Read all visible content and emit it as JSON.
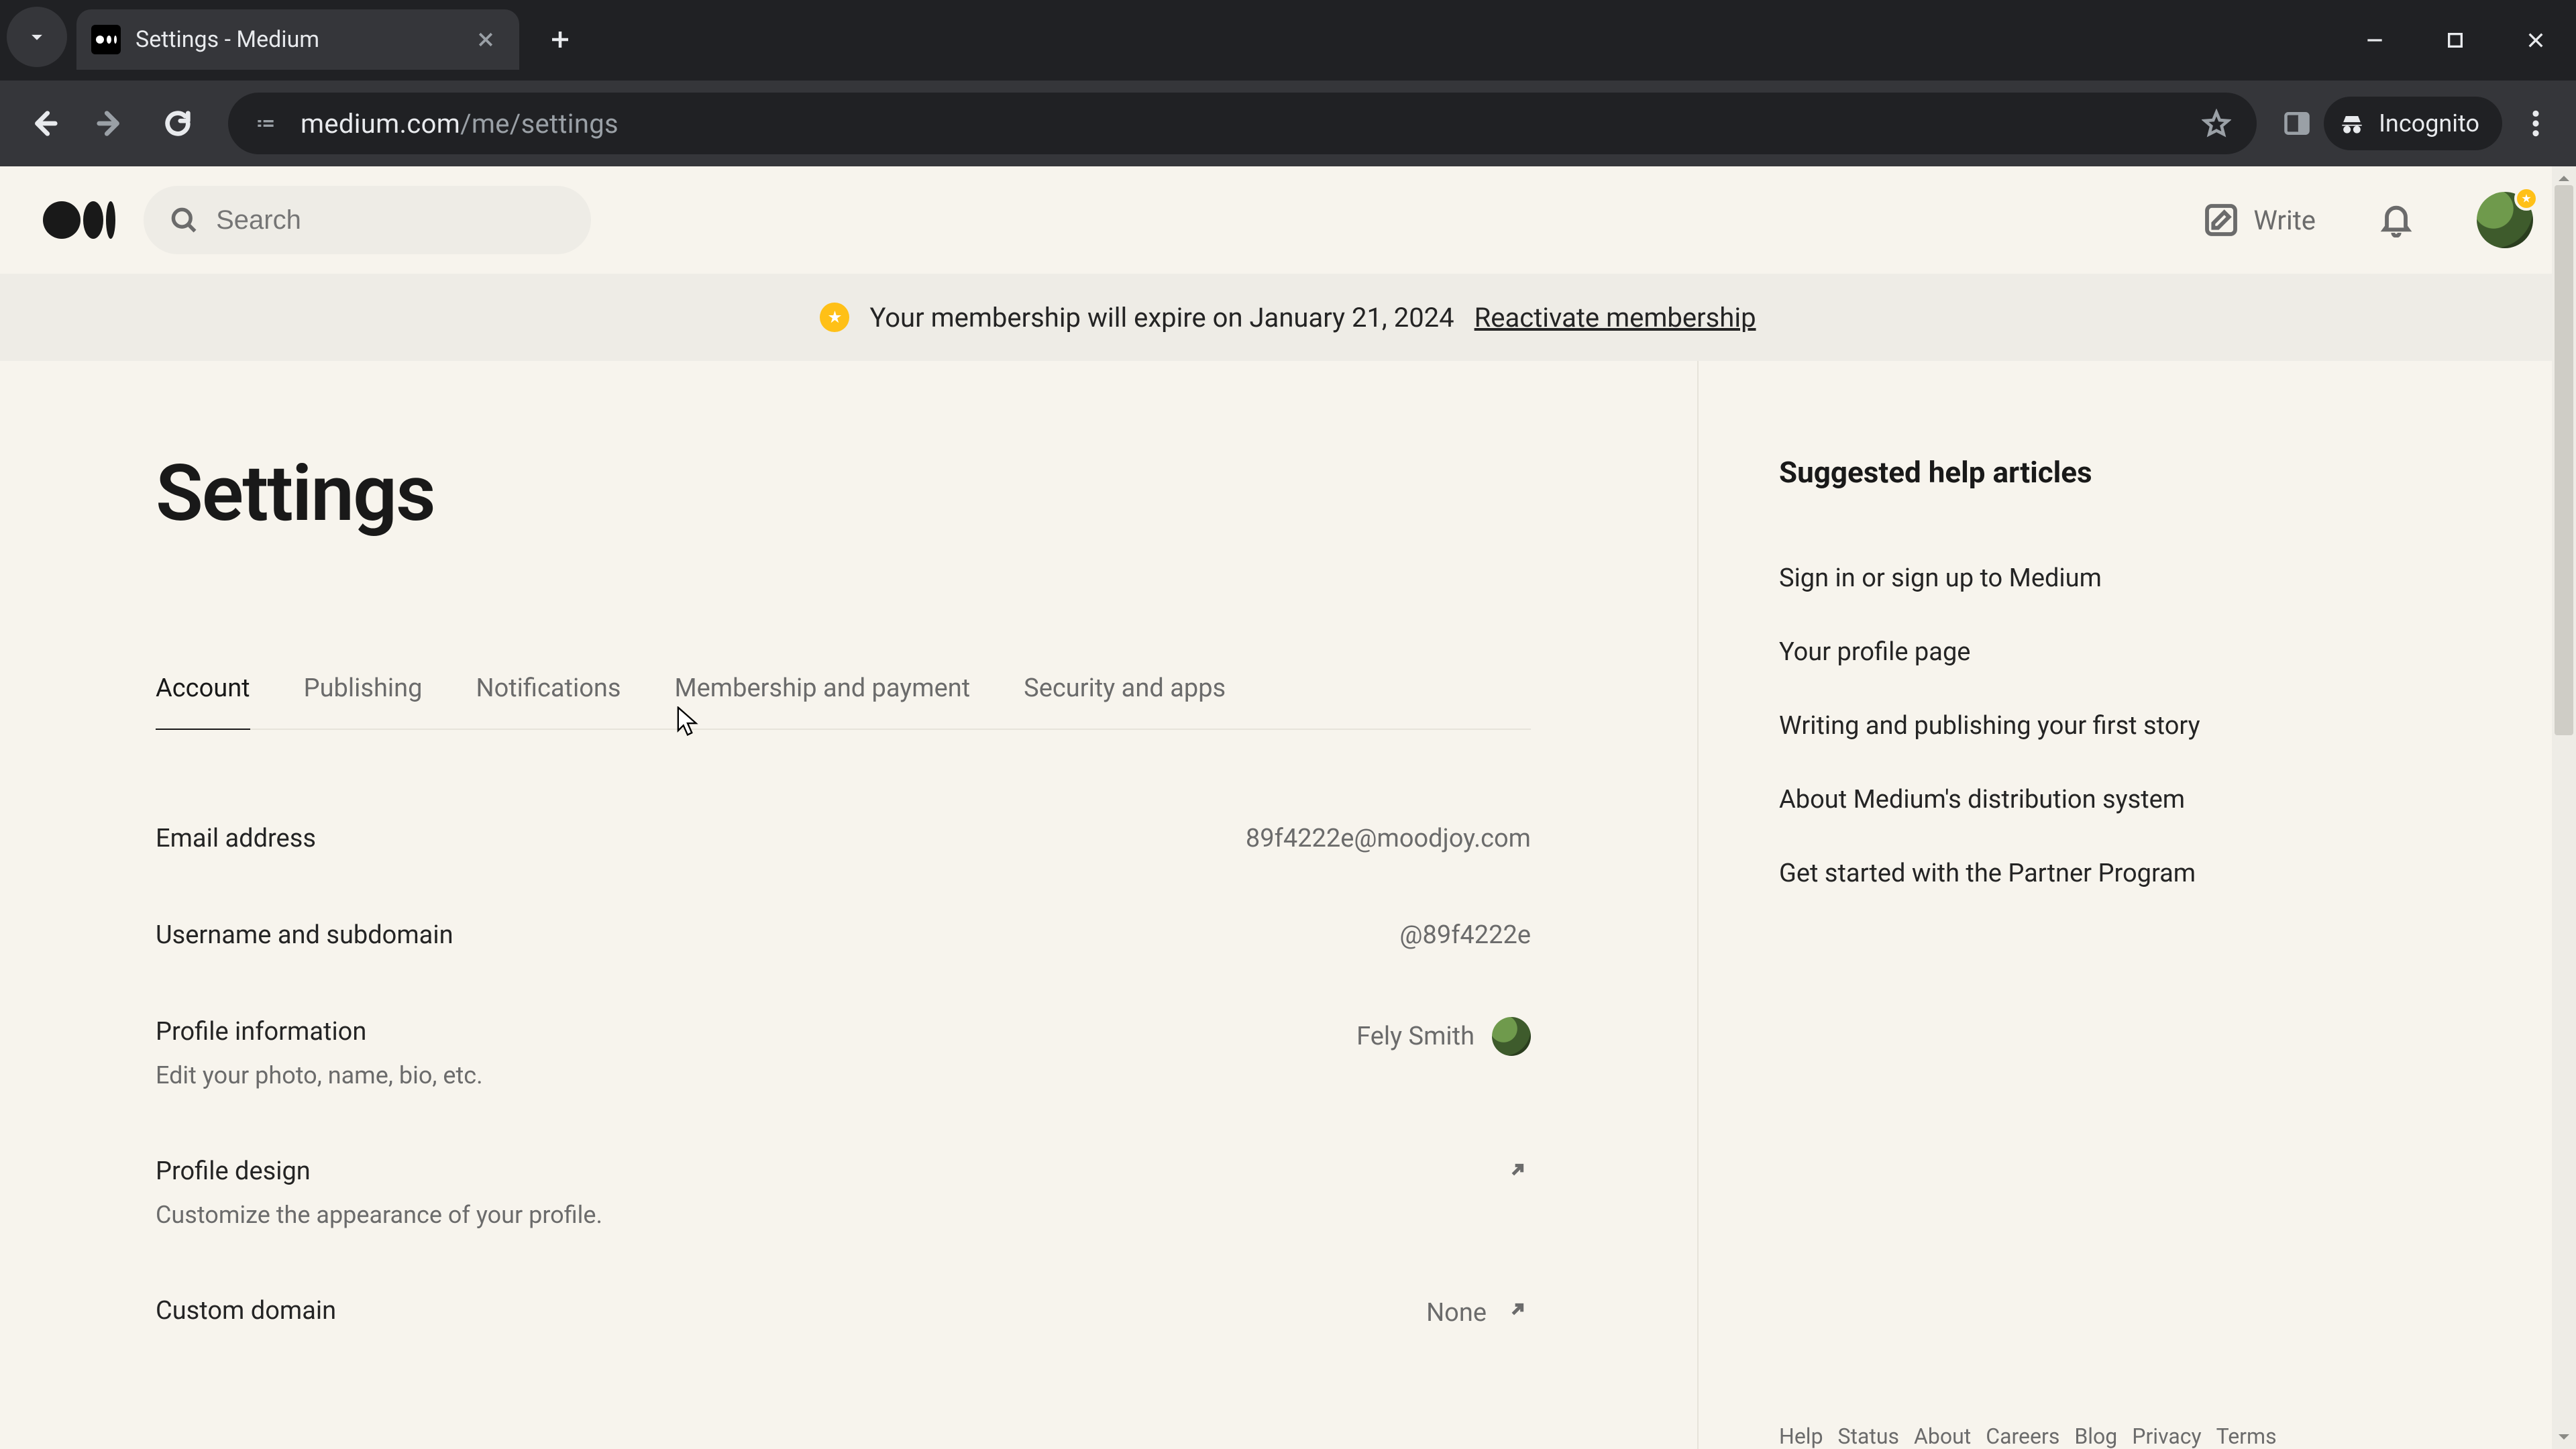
{
  "browser": {
    "tab_title": "Settings - Medium",
    "url_host": "medium.com",
    "url_path": "/me/settings",
    "incognito_label": "Incognito"
  },
  "header": {
    "search_placeholder": "Search",
    "write_label": "Write"
  },
  "banner": {
    "text": "Your membership will expire on January 21, 2024",
    "link": "Reactivate membership"
  },
  "page": {
    "title": "Settings",
    "tabs": [
      {
        "label": "Account"
      },
      {
        "label": "Publishing"
      },
      {
        "label": "Notifications"
      },
      {
        "label": "Membership and payment"
      },
      {
        "label": "Security and apps"
      }
    ],
    "rows": {
      "email": {
        "label": "Email address",
        "value": "89f4222e@moodjoy.com"
      },
      "username": {
        "label": "Username and subdomain",
        "value": "@89f4222e"
      },
      "profile": {
        "label": "Profile information",
        "sub": "Edit your photo, name, bio, etc.",
        "value": "Fely Smith"
      },
      "design": {
        "label": "Profile design",
        "sub": "Customize the appearance of your profile."
      },
      "domain": {
        "label": "Custom domain",
        "value": "None"
      }
    }
  },
  "sidebar": {
    "title": "Suggested help articles",
    "items": [
      "Sign in or sign up to Medium",
      "Your profile page",
      "Writing and publishing your first story",
      "About Medium's distribution system",
      "Get started with the Partner Program"
    ],
    "footer": [
      "Help",
      "Status",
      "About",
      "Careers",
      "Blog",
      "Privacy",
      "Terms"
    ]
  }
}
